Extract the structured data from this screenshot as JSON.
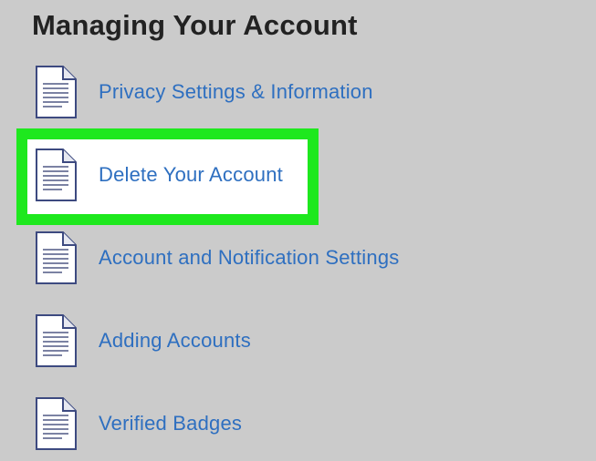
{
  "page": {
    "title": "Managing Your Account"
  },
  "articles": [
    {
      "label": "Privacy Settings & Information",
      "icon": "document-icon"
    },
    {
      "label": "Delete Your Account",
      "icon": "document-icon",
      "highlighted": true
    },
    {
      "label": "Account and Notification Settings",
      "icon": "document-icon"
    },
    {
      "label": "Adding Accounts",
      "icon": "document-icon"
    },
    {
      "label": "Verified Badges",
      "icon": "document-icon"
    }
  ],
  "colors": {
    "background": "#cbcbcb",
    "link": "#2e6fc0",
    "title": "#222222",
    "highlight_border": "#1ee81e",
    "highlight_fill": "#ffffff",
    "icon_stroke": "#3d4a80"
  }
}
